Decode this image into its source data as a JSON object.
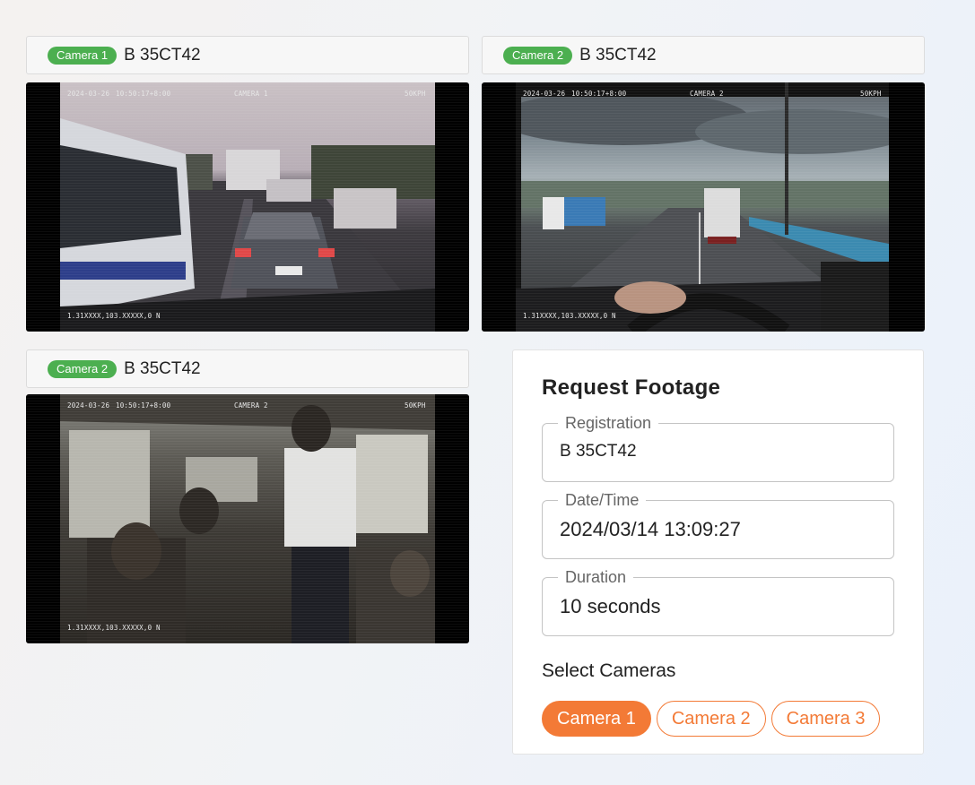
{
  "cameras": [
    {
      "badge": "Camera 1",
      "plate": "B 35CT42",
      "osd": {
        "date": "2024-03-26",
        "time": "10:50:17+8:00",
        "cam": "CAMERA 1",
        "speed": "50KPH",
        "coords": "1.31XXXX,103.XXXXX,0 N"
      }
    },
    {
      "badge": "Camera 2",
      "plate": "B 35CT42",
      "osd": {
        "date": "2024-03-26",
        "time": "10:50:17+8:00",
        "cam": "CAMERA 2",
        "speed": "50KPH",
        "coords": "1.31XXXX,103.XXXXX,0 N"
      }
    },
    {
      "badge": "Camera 2",
      "plate": "B 35CT42",
      "osd": {
        "date": "2024-03-26",
        "time": "10:50:17+8:00",
        "cam": "CAMERA 2",
        "speed": "50KPH",
        "coords": "1.31XXXX,103.XXXXX,0 N"
      }
    }
  ],
  "request": {
    "title": "Request Footage",
    "registration": {
      "label": "Registration",
      "value": "B 35CT42"
    },
    "datetime": {
      "label": "Date/Time",
      "value": "2024/03/14 13:09:27"
    },
    "duration": {
      "label": "Duration",
      "value": "10 seconds"
    },
    "select_label": "Select Cameras",
    "camera_options": [
      "Camera 1",
      "Camera 2",
      "Camera 3"
    ],
    "selected": "Camera 1"
  },
  "colors": {
    "accent": "#f37a36",
    "badge": "#4caf50"
  }
}
